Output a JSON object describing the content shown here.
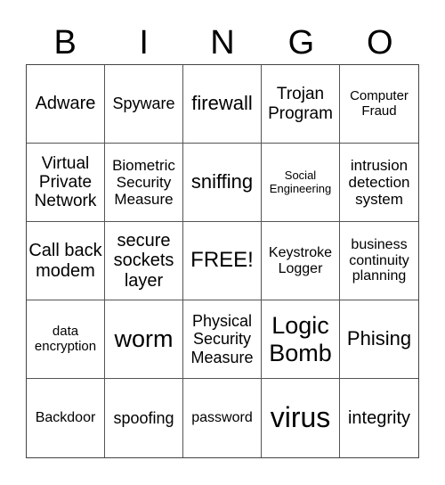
{
  "header": [
    "B",
    "I",
    "N",
    "G",
    "O"
  ],
  "cells": [
    "Adware",
    "Spyware",
    "firewall",
    "Trojan Program",
    "Computer Fraud",
    "Virtual Private Network",
    "Biometric Security Measure",
    "sniffing",
    "Social Engineering",
    "intrusion detection system",
    "Call back modem",
    "secure sockets layer",
    "FREE!",
    "Keystroke Logger",
    "business continuity planning",
    "data encryption",
    "worm",
    "Physical Security Measure",
    "Logic Bomb",
    "Phising",
    "Backdoor",
    "spoofing",
    "password",
    "virus",
    "integrity"
  ]
}
